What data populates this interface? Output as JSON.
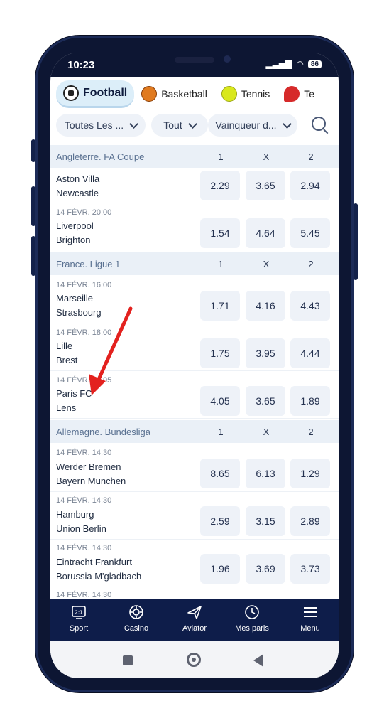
{
  "status": {
    "time": "10:23",
    "battery": "86"
  },
  "sports_tabs": [
    {
      "label": "Football",
      "icon": "football-icon"
    },
    {
      "label": "Basketball",
      "icon": "basketball-icon"
    },
    {
      "label": "Tennis",
      "icon": "tennis-icon"
    },
    {
      "label": "Te",
      "icon": "table-tennis-icon"
    }
  ],
  "filters": {
    "league": "Toutes Les ...",
    "period": "Tout",
    "market": "Vainqueur d..."
  },
  "columns": [
    "1",
    "X",
    "2"
  ],
  "leagues": [
    {
      "name": "Angleterre. FA Coupe",
      "matches": [
        {
          "date": "",
          "home": "Aston Villa",
          "away": "Newcastle",
          "odds": [
            "2.29",
            "3.65",
            "2.94"
          ]
        },
        {
          "date": "14 FÉVR. 20:00",
          "home": "Liverpool",
          "away": "Brighton",
          "odds": [
            "1.54",
            "4.64",
            "5.45"
          ]
        }
      ]
    },
    {
      "name": "France. Ligue 1",
      "matches": [
        {
          "date": "14 FÉVR. 16:00",
          "home": "Marseille",
          "away": "Strasbourg",
          "odds": [
            "1.71",
            "4.16",
            "4.43"
          ]
        },
        {
          "date": "14 FÉVR. 18:00",
          "home": "Lille",
          "away": "Brest",
          "odds": [
            "1.75",
            "3.95",
            "4.44"
          ]
        },
        {
          "date": "14 FÉVR. 18:05",
          "home": "Paris FC",
          "away": "Lens",
          "odds": [
            "4.05",
            "3.65",
            "1.89"
          ]
        }
      ]
    },
    {
      "name": "Allemagne. Bundesliga",
      "matches": [
        {
          "date": "14 FÉVR. 14:30",
          "home": "Werder Bremen",
          "away": "Bayern Munchen",
          "odds": [
            "8.65",
            "6.13",
            "1.29"
          ]
        },
        {
          "date": "14 FÉVR. 14:30",
          "home": "Hamburg",
          "away": "Union Berlin",
          "odds": [
            "2.59",
            "3.15",
            "2.89"
          ]
        },
        {
          "date": "14 FÉVR. 14:30",
          "home": "Eintracht Frankfurt",
          "away": "Borussia M'gladbach",
          "odds": [
            "1.96",
            "3.69",
            "3.73"
          ]
        }
      ]
    }
  ],
  "next_date": "14 FÉVR. 14:30",
  "bottom_nav": [
    {
      "label": "Sport",
      "icon": "sport-icon"
    },
    {
      "label": "Casino",
      "icon": "casino-chip-icon"
    },
    {
      "label": "Aviator",
      "icon": "plane-icon"
    },
    {
      "label": "Mes paris",
      "icon": "clock-icon"
    },
    {
      "label": "Menu",
      "icon": "hamburger-menu-icon"
    }
  ],
  "colors": {
    "accent": "#0e1d4a",
    "league_header": "#eaf0f7",
    "odd_bg": "#eef2f8",
    "arrow": "#e3211e"
  }
}
